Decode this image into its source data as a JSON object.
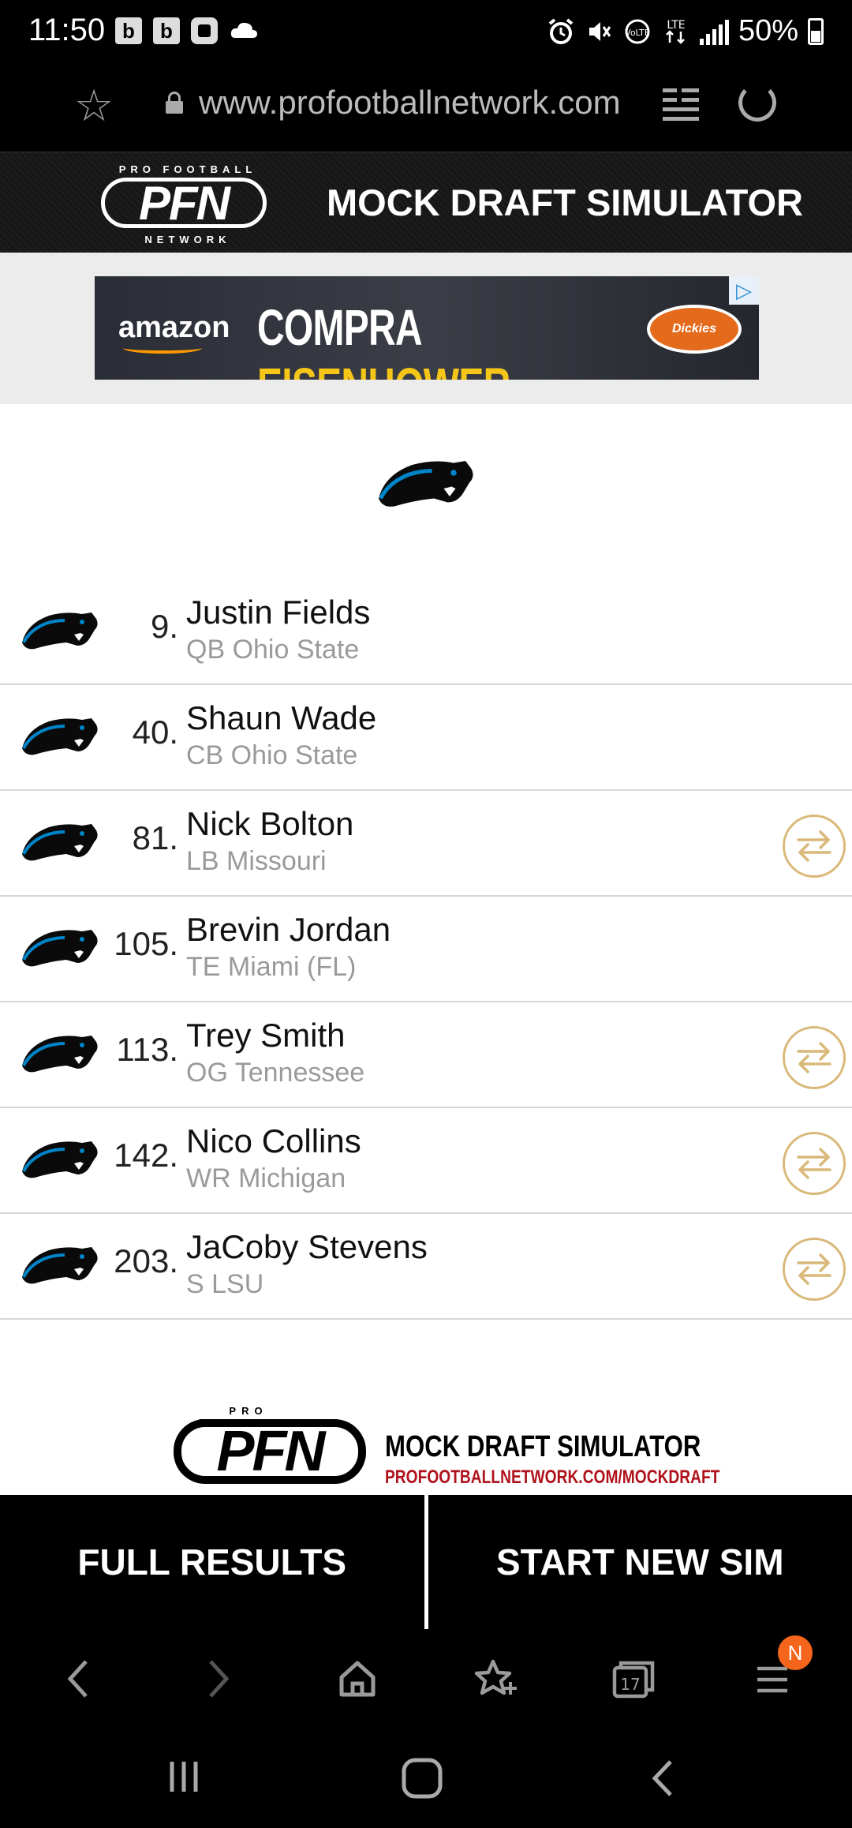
{
  "status_bar": {
    "time": "11:50",
    "left_icons": [
      "b",
      "b"
    ],
    "battery": "50%"
  },
  "url_bar": {
    "url": "www.profootballnetwork.com"
  },
  "header": {
    "logo_top": "PRO FOOTBALL",
    "logo_main": "PFN",
    "logo_bottom": "NETWORK",
    "title": "MOCK DRAFT SIMULATOR"
  },
  "ad": {
    "brand": "amazon",
    "headline_white": "COMPRA ",
    "headline_yellow": "EISENHOWER ›",
    "partner": "Dickies"
  },
  "picks": [
    {
      "number": "9.",
      "name": "Justin Fields",
      "detail": "QB Ohio State",
      "tradable": false
    },
    {
      "number": "40.",
      "name": "Shaun Wade",
      "detail": "CB Ohio State",
      "tradable": false
    },
    {
      "number": "81.",
      "name": "Nick Bolton",
      "detail": "LB Missouri",
      "tradable": true
    },
    {
      "number": "105.",
      "name": "Brevin Jordan",
      "detail": "TE Miami (FL)",
      "tradable": false
    },
    {
      "number": "113.",
      "name": "Trey Smith",
      "detail": "OG Tennessee",
      "tradable": true
    },
    {
      "number": "142.",
      "name": "Nico Collins",
      "detail": "WR Michigan",
      "tradable": true
    },
    {
      "number": "203.",
      "name": "JaCoby Stevens",
      "detail": "S LSU",
      "tradable": true
    }
  ],
  "footer_logo": {
    "top": "PRO FOOTBALL",
    "main": "PFN",
    "title": "MOCK DRAFT SIMULATOR",
    "url": "PROFOOTBALLNETWORK.COM/MOCKDRAFT"
  },
  "actions": {
    "full_results": "FULL RESULTS",
    "start_new_sim": "START NEW SIM"
  },
  "browser_nav": {
    "tabs_count": "17",
    "menu_badge": "N"
  },
  "colors": {
    "accent_gold": "#d9b879",
    "badge_orange": "#f5651b",
    "panther_blue": "#0085ca"
  }
}
